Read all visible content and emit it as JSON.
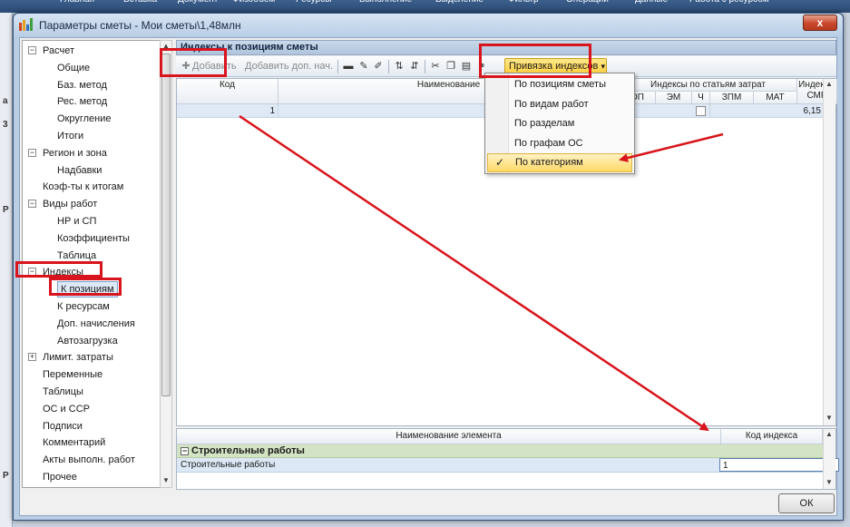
{
  "backdrop": {
    "ribbon_tabs": [
      "Главная",
      "Вставка",
      "Документ",
      "Физобъем",
      "Ресурсы",
      "Выполнение",
      "Выделение",
      "Фильтр",
      "Операции",
      "Данные",
      "Работа с ресурсом"
    ],
    "left_letters": [
      "а",
      "3",
      "Р",
      "Р"
    ]
  },
  "window": {
    "title": "Параметры сметы - Мои сметы\\1,48млн",
    "close_glyph": "x"
  },
  "tree": {
    "items": [
      {
        "label": "Расчет",
        "expander": "−",
        "level": 0
      },
      {
        "label": "Общие",
        "level": 1
      },
      {
        "label": "Баз. метод",
        "level": 1
      },
      {
        "label": "Рес. метод",
        "level": 1
      },
      {
        "label": "Округление",
        "level": 1
      },
      {
        "label": "Итоги",
        "level": 1
      },
      {
        "label": "Регион и зона",
        "expander": "−",
        "level": 0
      },
      {
        "label": "Надбавки",
        "level": 1
      },
      {
        "label": "Коэф-ты к итогам",
        "level": 0
      },
      {
        "label": "Виды работ",
        "expander": "−",
        "level": 0
      },
      {
        "label": "НР и СП",
        "level": 1
      },
      {
        "label": "Коэффициенты",
        "level": 1
      },
      {
        "label": "Таблица",
        "level": 1
      },
      {
        "label": "Индексы",
        "expander": "−",
        "level": 0
      },
      {
        "label": "К позициям",
        "level": 1,
        "selected": true
      },
      {
        "label": "К ресурсам",
        "level": 1
      },
      {
        "label": "Доп. начисления",
        "level": 1
      },
      {
        "label": "Автозагрузка",
        "level": 1
      },
      {
        "label": "Лимит. затраты",
        "expander": "+",
        "level": 0
      },
      {
        "label": "Переменные",
        "level": 0
      },
      {
        "label": "Таблицы",
        "level": 0
      },
      {
        "label": "ОС и ССР",
        "level": 0
      },
      {
        "label": "Подписи",
        "level": 0
      },
      {
        "label": "Комментарий",
        "level": 0
      },
      {
        "label": "Акты выполн. работ",
        "level": 0
      },
      {
        "label": "Прочее",
        "level": 0
      }
    ]
  },
  "panel": {
    "title": "Индексы к позициям сметы"
  },
  "toolbar": {
    "add_label": "Добавить",
    "add_extra_label": "Добавить доп. нач.",
    "binding_label": "Привязка индексов",
    "binding_arrow": "▾"
  },
  "dropdown": {
    "items": [
      "По позициям сметы",
      "По видам работ",
      "По разделам",
      "По графам ОС",
      "По категориям"
    ],
    "checked_index": 4,
    "check_glyph": "✓"
  },
  "top_grid": {
    "col_code": "Код",
    "col_name": "Наименование",
    "col_group": "Индексы по статьям затрат",
    "col_op": "ОП",
    "col_em": "ЭМ",
    "col_ch": "Ч",
    "col_zpm": "ЗПМ",
    "col_mat": "МАТ",
    "col_smr": "Индекс к СМР",
    "row": {
      "code": "1",
      "smr": "6,15"
    }
  },
  "bottom_grid": {
    "col_name": "Наименование элемента",
    "col_code": "Код индекса",
    "group": "Строительные работы",
    "row_name": "Строительные работы",
    "row_code": "1"
  },
  "footer": {
    "ok_label": "ОК"
  },
  "colors": {
    "annotation_red": "#d8141c",
    "binding_button": "#ffcf3c",
    "group_row": "#d3e4c4"
  }
}
